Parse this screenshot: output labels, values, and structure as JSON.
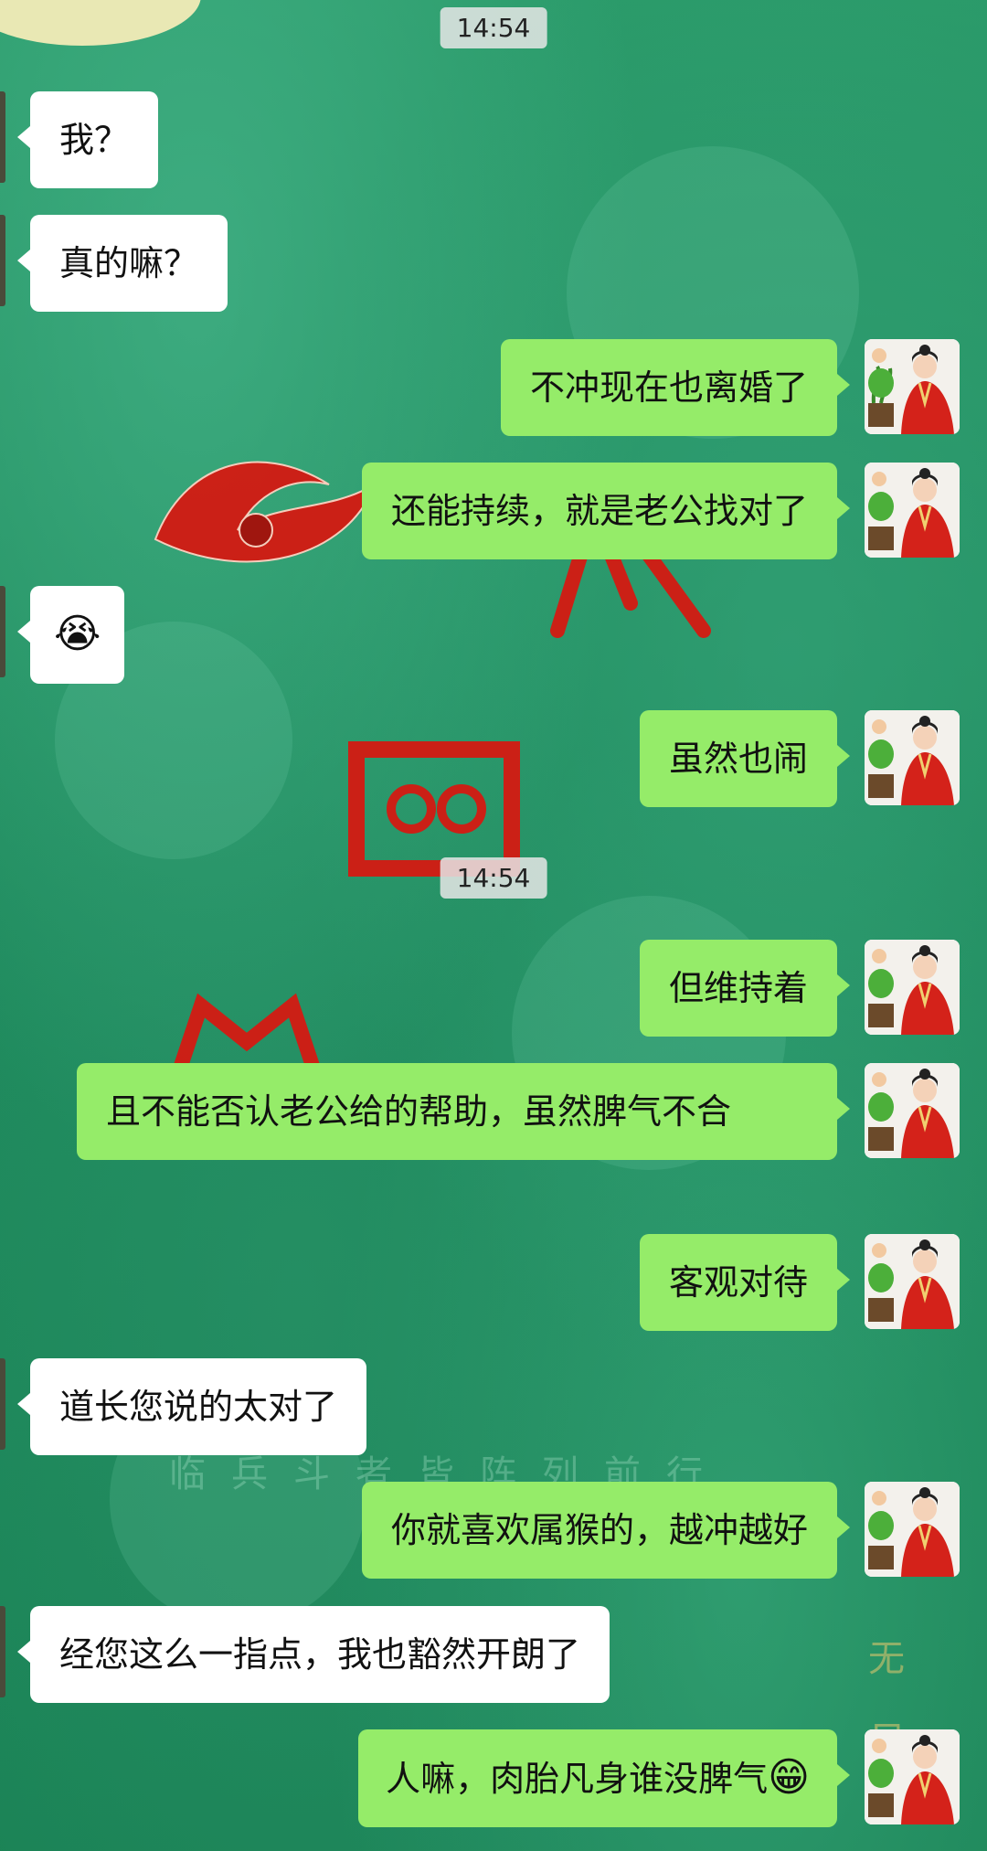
{
  "timestamps": [
    "14:54",
    "14:54"
  ],
  "background_text": {
    "faint_line": "临兵斗者皆阵列前行",
    "faint_side": "无尽"
  },
  "colors": {
    "incoming_bubble": "#ffffff",
    "outgoing_bubble": "#95ec69",
    "background": "#1f8b5e"
  },
  "messages": [
    {
      "side": "in",
      "text": "我？"
    },
    {
      "side": "in",
      "text": "真的嘛？"
    },
    {
      "side": "out",
      "text": "不冲现在也离婚了"
    },
    {
      "side": "out",
      "text": "还能持续，就是老公找对了"
    },
    {
      "side": "in",
      "emoji": "😭"
    },
    {
      "side": "out",
      "text": "虽然也闹"
    },
    {
      "side": "out",
      "text": "但维持着"
    },
    {
      "side": "out",
      "text": "且不能否认老公给的帮助，虽然脾气不合"
    },
    {
      "side": "out",
      "text": "客观对待"
    },
    {
      "side": "in",
      "text": "道长您说的太对了"
    },
    {
      "side": "out",
      "text": "你就喜欢属猴的，越冲越好"
    },
    {
      "side": "in",
      "text": "经您这么一指点，我也豁然开朗了"
    },
    {
      "side": "out",
      "text": "人嘛，肉胎凡身谁没脾气",
      "emoji": "😁"
    }
  ]
}
